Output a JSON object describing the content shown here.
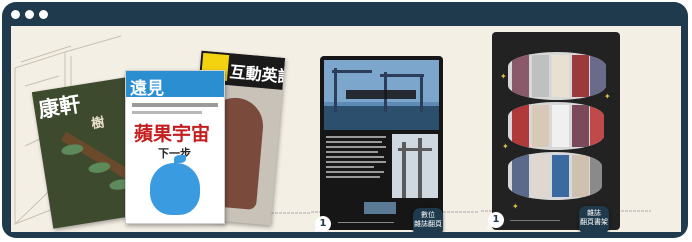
{
  "magazines": [
    {
      "title": "康軒",
      "subtitle": "樹"
    },
    {
      "title": "遠見",
      "headline": "蘋果宇宙",
      "subhead": "下一步"
    },
    {
      "title": "互動英語"
    }
  ],
  "tablets": [
    {
      "page_number": "1",
      "button_lines": [
        "數位",
        "雜誌翻頁"
      ]
    },
    {
      "page_number": "1",
      "button_lines": [
        "雜誌",
        "翻頁書架"
      ]
    }
  ],
  "colors": {
    "frame": "#1f3a4c",
    "canvas": "#f4efe5",
    "accent_red": "#c41e1e",
    "accent_blue": "#2a8ed0"
  },
  "icons": [
    "window-dot-icon",
    "star-icon"
  ]
}
